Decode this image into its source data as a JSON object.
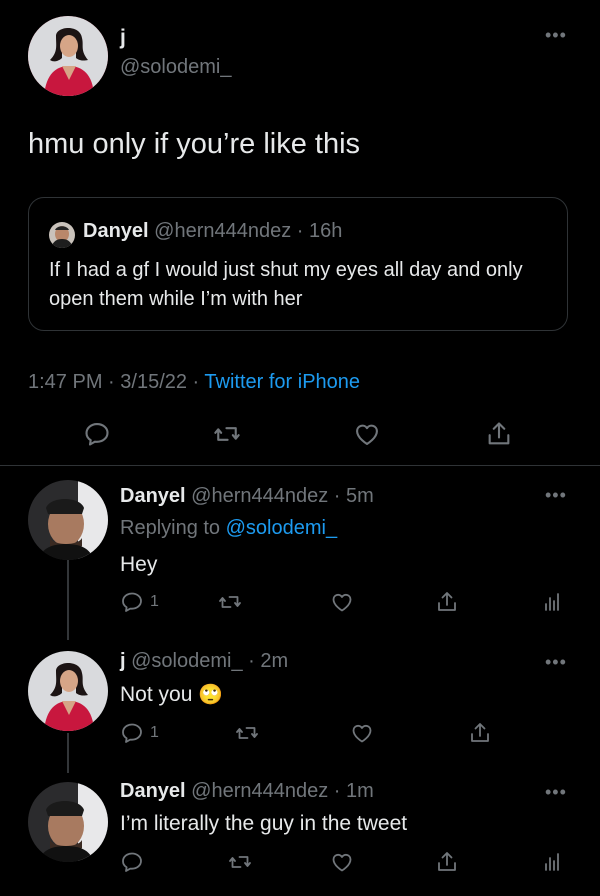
{
  "main_tweet": {
    "display_name": "j",
    "handle": "@solodemi_",
    "text": "hmu only if you’re like this",
    "quoted": {
      "display_name": "Danyel",
      "handle": "@hern444ndez",
      "sep": " · ",
      "time": "16h",
      "text": "If I had a gf I would just shut my eyes all day and only open them while I’m with her"
    },
    "meta": {
      "time": "1:47 PM",
      "sep1": " · ",
      "date": "3/15/22",
      "sep2": " · ",
      "source": "Twitter for iPhone"
    }
  },
  "replies": [
    {
      "display_name": "Danyel",
      "handle": "@hern444ndez",
      "sep": " · ",
      "time": "5m",
      "replying_prefix": "Replying to ",
      "replying_handle": "@solodemi_",
      "text": "Hey",
      "reply_count": "1"
    },
    {
      "display_name": "j",
      "handle": "@solodemi_",
      "sep": " · ",
      "time": "2m",
      "text": "Not you",
      "emoji": "🙄",
      "reply_count": "1"
    },
    {
      "display_name": "Danyel",
      "handle": "@hern444ndez",
      "sep": " · ",
      "time": "1m",
      "text": "I’m literally the guy in the tweet"
    }
  ],
  "icons": {
    "reply": "reply-icon",
    "retweet": "retweet-icon",
    "like": "heart-icon",
    "share": "share-icon",
    "analytics": "analytics-icon",
    "more": "more-icon"
  },
  "colors": {
    "background": "#000000",
    "text": "#e7e9ea",
    "muted": "#71767b",
    "accent": "#1d9bf0"
  }
}
